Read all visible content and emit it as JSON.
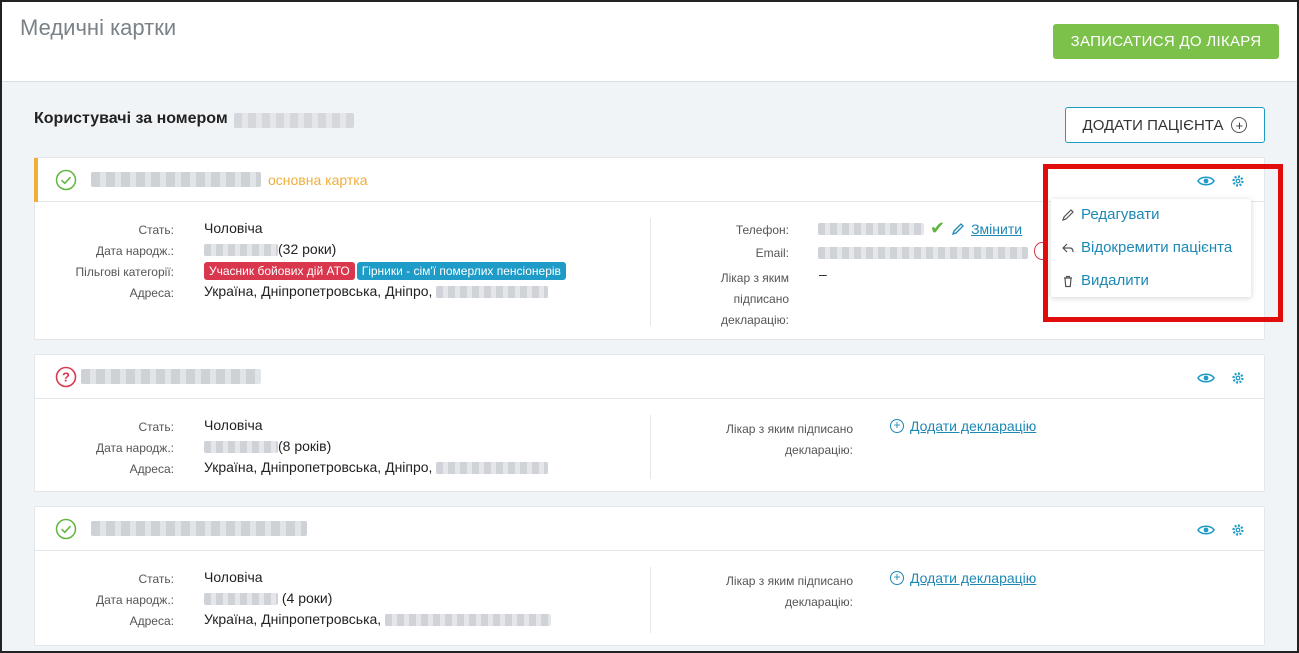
{
  "header": {
    "title": "Медичні картки",
    "book_button": "ЗАПИСАТИСЯ ДО ЛІКАРЯ"
  },
  "users": {
    "title": "Користувачі за номером",
    "add_patient_button": "ДОДАТИ ПАЦІЄНТА"
  },
  "labels": {
    "sex": "Стать:",
    "dob": "Дата народж.:",
    "categories": "Пільгові категорії:",
    "address": "Адреса:",
    "phone": "Телефон:",
    "email": "Email:",
    "doctor_declaration_lines": [
      "Лікар з яким",
      "підписано",
      "декларацію:"
    ],
    "doctor_declaration_short": [
      "Лікар з яким підписано",
      "декларацію:"
    ]
  },
  "cards": [
    {
      "status": "verified",
      "main_label": "основна картка",
      "sex": "Чоловіча",
      "age": "(32 роки)",
      "categories": [
        "Учасник бойових дій АТО",
        "Гірники - сім'ї померлих пенсіонерів"
      ],
      "address": "Україна, Дніпропетровська, Дніпро,",
      "change_link": "Змінити",
      "doctor": "–"
    },
    {
      "status": "unverified",
      "sex": "Чоловіча",
      "age": "(8 років)",
      "address": "Україна, Дніпропетровська, Дніпро,",
      "add_declaration": "Додати декларацію"
    },
    {
      "status": "verified",
      "sex": "Чоловіча",
      "age": "(4 роки)",
      "address": "Україна, Дніпропетровська,",
      "add_declaration": "Додати декларацію"
    }
  ],
  "menu": {
    "items": [
      {
        "label": "Редагувати",
        "icon": "pencil-icon"
      },
      {
        "label": "Відокремити пацієнта",
        "icon": "reply-icon"
      },
      {
        "label": "Видалити",
        "icon": "trash-icon"
      }
    ]
  },
  "colors": {
    "accent": "#1e9bc7",
    "primary_button": "#7cc14a",
    "main_card_accent": "#f0ad3c",
    "highlight_frame": "#e10c0c"
  }
}
